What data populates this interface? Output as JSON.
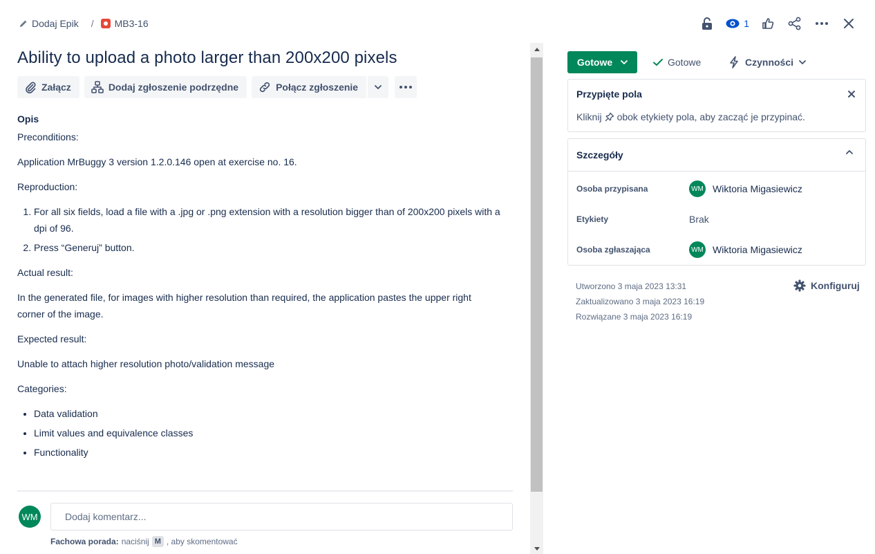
{
  "breadcrumb": {
    "epic_label": "Dodaj Epik",
    "separator": "/",
    "issue_key": "MB3-16"
  },
  "top_actions": {
    "watchers_count": "1",
    "icons": [
      "unlock-icon",
      "eye-icon",
      "thumbs-up-icon",
      "share-icon",
      "more-icon",
      "close-icon"
    ]
  },
  "issue": {
    "title": "Ability to upload a photo larger than 200x200 pixels"
  },
  "toolbar": {
    "attach_label": "Załącz",
    "add_subtask_label": "Dodaj zgłoszenie podrzędne",
    "link_issue_label": "Połącz zgłoszenie"
  },
  "description": {
    "heading": "Opis",
    "preconditions_label": "Preconditions:",
    "preconditions_text": "Application MrBuggy 3 version 1.2.0.146 open at exercise no. 16.",
    "reproduction_label": "Reproduction:",
    "steps": [
      "For all six fields, load a file with a .jpg or .png extension with a resolution bigger than of 200x200 pixels with a dpi of 96.",
      "Press “Generuj” button."
    ],
    "actual_label": "Actual result:",
    "actual_text": "In the generated file, for images with higher resolution than required, the application pastes the upper right corner of the image.",
    "expected_label": "Expected result:",
    "expected_text": "Unable to attach higher resolution photo/validation message",
    "categories_label": "Categories:",
    "categories": [
      "Data validation",
      "Limit values and equivalence classes",
      "Functionality"
    ]
  },
  "comment": {
    "avatar_initials": "WM",
    "placeholder": "Dodaj komentarz...",
    "tip_bold": "Fachowa porada:",
    "tip_before": "naciśnij",
    "tip_key": "M",
    "tip_after": ", aby skomentować"
  },
  "status": {
    "current": "Gotowe",
    "transition": "Gotowe",
    "actions_label": "Czynności",
    "color": "#00875a"
  },
  "pinned": {
    "title": "Przypięte pola",
    "text_before": "Kliknij",
    "text_after": "obok etykiety pola, aby zacząć je przypinać."
  },
  "details": {
    "title": "Szczegóły",
    "assignee_label": "Osoba przypisana",
    "assignee_initials": "WM",
    "assignee_name": "Wiktoria Migasiewicz",
    "labels_label": "Etykiety",
    "labels_value": "Brak",
    "reporter_label": "Osoba zgłaszająca",
    "reporter_initials": "WM",
    "reporter_name": "Wiktoria Migasiewicz"
  },
  "meta": {
    "created": "Utworzono 3 maja 2023 13:31",
    "updated": "Zaktualizowano 3 maja 2023 16:19",
    "resolved": "Rozwiązane 3 maja 2023 16:19",
    "configure_label": "Konfiguruj"
  }
}
